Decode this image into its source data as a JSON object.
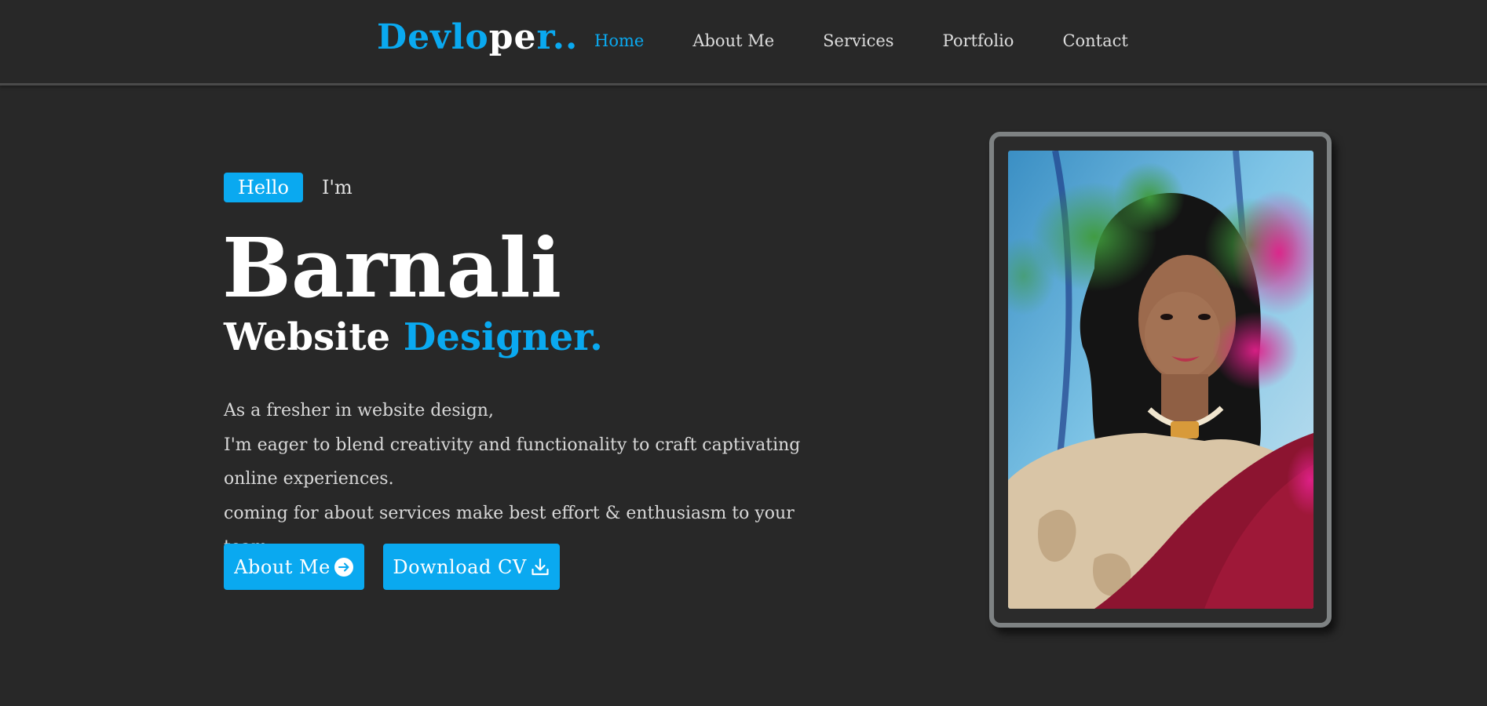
{
  "logo": {
    "part1": "Devlo",
    "part2": "pe",
    "part3": "r.."
  },
  "nav": {
    "items": [
      "Home",
      "About Me",
      "Services",
      "Portfolio",
      "Contact"
    ],
    "active": "Home"
  },
  "hero": {
    "hello_badge": "Hello",
    "intro": "I'm",
    "name": "Barnali",
    "role_main": "Website",
    "role_accent": "Designer.",
    "description": [
      "As a fresher in website design,",
      "I'm eager to blend creativity and functionality to craft captivating",
      "online experiences.",
      "coming for about services make best effort & enthusiasm to your team."
    ],
    "buttons": {
      "about": "About Me",
      "cv": "Download CV"
    }
  },
  "colors": {
    "accent": "#0aa9f0",
    "background": "#282828",
    "frame": "#7e8283"
  },
  "icons": {
    "about_button_icon": "arrow-right-circle-icon",
    "cv_button_icon": "download-icon"
  }
}
